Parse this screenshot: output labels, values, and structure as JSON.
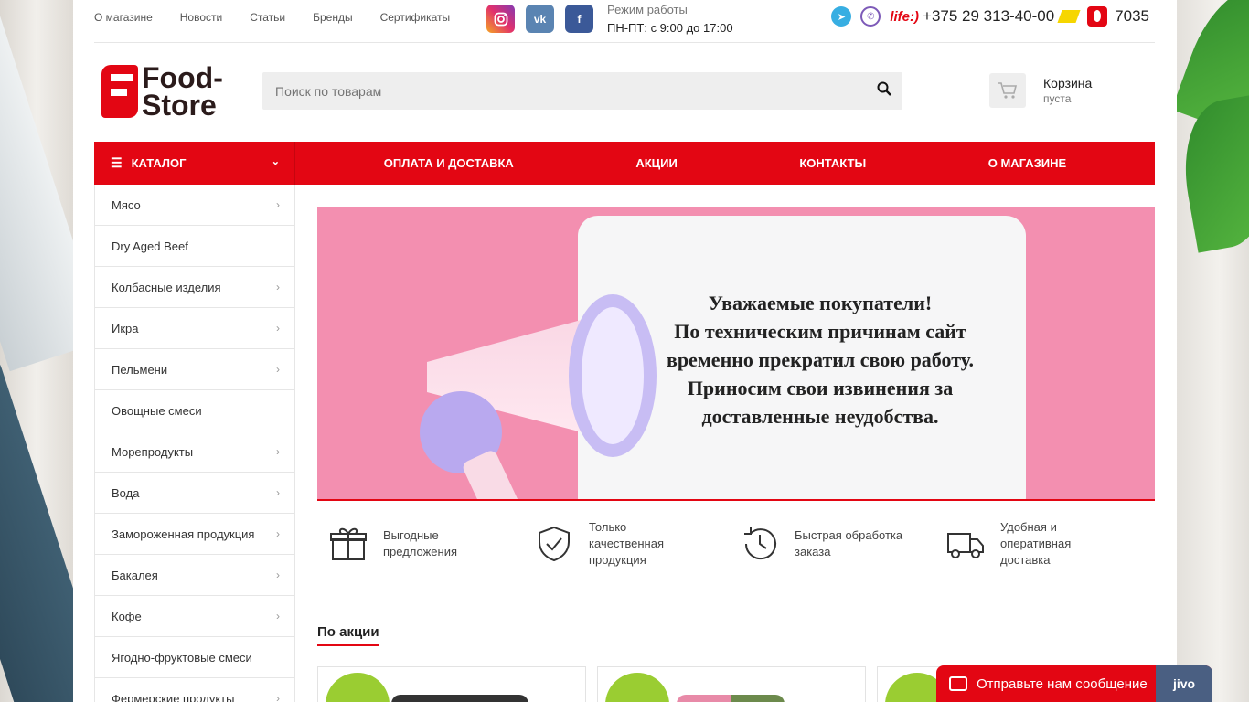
{
  "topbar": {
    "nav": [
      "О магазине",
      "Новости",
      "Статьи",
      "Бренды",
      "Сертификаты"
    ],
    "hours_label": "Режим работы",
    "hours_value": "ПН-ПТ: с 9:00 до 17:00",
    "life_label": "life:)",
    "phone_main": "+375 29 313-40-00",
    "phone_short": "7035"
  },
  "header": {
    "logo_line1": "Food-",
    "logo_line2": "Store",
    "search_placeholder": "Поиск по товарам",
    "cart_title": "Корзина",
    "cart_status": "пуста"
  },
  "mainnav": {
    "catalog_label": "КАТАЛОГ",
    "links": [
      "ОПЛАТА И ДОСТАВКА",
      "АКЦИИ",
      "КОНТАКТЫ",
      "О МАГАЗИНЕ"
    ]
  },
  "sidebar": {
    "items": [
      {
        "label": "Мясо",
        "has_sub": true
      },
      {
        "label": "Dry Aged Beef",
        "has_sub": false
      },
      {
        "label": "Колбасные изделия",
        "has_sub": true
      },
      {
        "label": "Икра",
        "has_sub": true
      },
      {
        "label": "Пельмени",
        "has_sub": true
      },
      {
        "label": "Овощные смеси",
        "has_sub": false
      },
      {
        "label": "Морепродукты",
        "has_sub": true
      },
      {
        "label": "Вода",
        "has_sub": true
      },
      {
        "label": "Замороженная продукция",
        "has_sub": true
      },
      {
        "label": "Бакалея",
        "has_sub": true
      },
      {
        "label": "Кофе",
        "has_sub": true
      },
      {
        "label": "Ягодно-фруктовые смеси",
        "has_sub": false
      },
      {
        "label": "Фермерские продукты",
        "has_sub": true
      }
    ]
  },
  "banner": {
    "lines": [
      "Уважаемые покупатели!",
      "По техническим причинам сайт",
      "временно прекратил свою работу.",
      "Приносим свои извинения за",
      "доставленные неудобства."
    ]
  },
  "features": [
    {
      "icon": "gift-icon",
      "text": "Выгодные предложения"
    },
    {
      "icon": "shield-check-icon",
      "text": "Только качественная продукция"
    },
    {
      "icon": "clock-icon",
      "text": "Быстрая обработка заказа"
    },
    {
      "icon": "truck-icon",
      "text": "Удобная и оперативная доставка"
    }
  ],
  "section": {
    "title": "По акции"
  },
  "chat": {
    "label": "Отправьте нам сообщение",
    "brand": "jivo"
  },
  "colors": {
    "accent": "#e30613",
    "banner_bg": "#f38fb0",
    "badge": "#9acd32"
  }
}
